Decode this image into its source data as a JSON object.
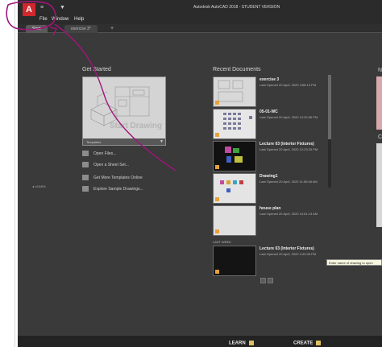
{
  "window": {
    "title": "Autodesk AutoCAD 2018 - STUDENT VERSION",
    "app_button_label": "A",
    "qat_label": "≡",
    "qat_dropdown": "▼"
  },
  "menubar": {
    "items": [
      "File",
      "Window",
      "Help"
    ]
  },
  "tabs": [
    {
      "label": "Start",
      "active": true
    },
    {
      "label": "exercise 3*",
      "active": false
    }
  ],
  "tab_add": "+",
  "sidebar": {
    "learn_label": "LEARN"
  },
  "get_started": {
    "title": "Get Started",
    "start_label": "Start Drawing",
    "templates_label": "Templates",
    "templates_dd": "▼",
    "links": [
      "Open Files...",
      "Open a Sheet Set...",
      "Get More Templates Online",
      "Explore Sample Drawings..."
    ]
  },
  "recent": {
    "title": "Recent Documents",
    "documents": [
      {
        "name": "exercise 3",
        "opened": "Last Opened 20 April, 2020 3:58:13 PM"
      },
      {
        "name": "05-01-WC",
        "opened": "Last Opened 20 April, 2020 12:25:06 PM"
      },
      {
        "name": "Lecture 03 (Interior Fixtures)",
        "opened": "Last Opened 20 April, 2020 12:23:29 PM"
      },
      {
        "name": "Drawing1",
        "opened": "Last Opened 20 April, 2020 11:50:48 AM"
      },
      {
        "name": "house plan",
        "opened": "Last Opened 20 April, 2020 10:51:13 AM"
      },
      {
        "name": "Lecture 03 (Interior Fixtures)",
        "opened": "Last Opened 20 April, 2020 3:43:08 PM"
      }
    ],
    "last_week_label": "LAST WEEK",
    "tooltip": "Enter name of drawing to open"
  },
  "right_panel": {
    "top_letter": "N",
    "bottom_letter": "C"
  },
  "bottom": {
    "learn": "LEARN",
    "create": "CREATE"
  },
  "colors": {
    "app_red": "#d0282c",
    "annotation": "#a0157a",
    "background": "#3a3a3a"
  }
}
